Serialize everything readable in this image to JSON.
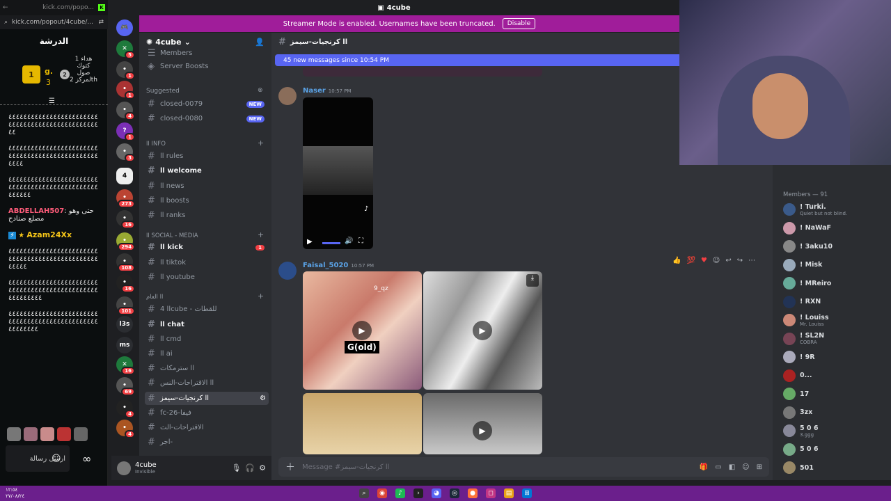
{
  "kick": {
    "url": "kick.com/popout/4cube/...",
    "tab_title": "kick.com/popo...",
    "header": "الدرشة",
    "leaderboard": {
      "first_rank": "1",
      "first_name": "g.",
      "first_score": "3",
      "second_rank": "2",
      "second_text": "هداء 1 كتوك صول لمركز 2th"
    },
    "messages": [
      "٤٤٤٤٤٤٤٤٤٤٤٤٤٤٤٤٤٤٤٤٤٤٤٤٤٤٤٤٤٤٤٤٤٤٤٤٤٤٤٤٤٤٤٤٤٤٤٤٤٤",
      "٤٤٤٤٤٤٤٤٤٤٤٤٤٤٤٤٤٤٤٤٤٤٤٤٤٤٤٤٤٤٤٤٤٤٤٤٤٤٤٤٤٤٤٤٤٤٤٤٤٤٤٤",
      "٤٤٤٤٤٤٤٤٤٤٤٤٤٤٤٤٤٤٤٤٤٤٤٤٤٤٤٤٤٤٤٤٤٤٤٤٤٤٤٤٤٤٤٤٤٤٤٤٤٤٤٤٤٤"
    ],
    "user1": "ABDELLAH507",
    "user1_msg": "حتى وهو مصلع صنادح",
    "user2": "Azam24Xx",
    "messages2": [
      "٤٤٤٤٤٤٤٤٤٤٤٤٤٤٤٤٤٤٤٤٤٤٤٤٤٤٤٤٤٤٤٤٤٤٤٤٤٤٤٤٤٤٤٤٤٤٤٤٤٤٤٤٤",
      "٤٤٤٤٤٤٤٤٤٤٤٤٤٤٤٤٤٤٤٤٤٤٤٤٤٤٤٤٤٤٤٤٤٤٤٤٤٤٤٤٤٤٤٤٤٤٤٤٤٤٤٤٤٤٤٤٤",
      "٤٤٤٤٤٤٤٤٤٤٤٤٤٤٤٤٤٤٤٤٤٤٤٤٤٤٤٤٤٤٤٤٤٤٤٤٤٤٤٤٤٤٤٤٤٤٤٤٤٤٤٤٤٤٤٤"
    ],
    "input_placeholder": "ارسل رسالة"
  },
  "discord": {
    "window_title": "4cube",
    "streamer_text": "Streamer Mode is enabled. Usernames have been truncated.",
    "disable_label": "Disable",
    "server_name": "4cube",
    "channels_top": [
      {
        "name": "Members"
      },
      {
        "name": "Server Boosts"
      }
    ],
    "suggested_label": "Suggested",
    "suggested": [
      {
        "name": "closed-0079",
        "badge": "NEW"
      },
      {
        "name": "closed-0080",
        "badge": "NEW"
      }
    ],
    "cat_info": "اا info",
    "info_channels": [
      "اا rules",
      "اا welcome",
      "اا news",
      "اا boosts",
      "اا ranks"
    ],
    "cat_social": "اا social - media",
    "social_channels": [
      "اا kick",
      "اا tiktok",
      "اا youtube"
    ],
    "cat_general": "اا العام",
    "general_channels": [
      "اا 4cube - للقطات",
      "اا chat",
      "اا cmd",
      "اا ai",
      "اا سترمكات",
      "اا الاقتراحات-النس",
      "اا كرنجيات-سيمز",
      "fc-26-فيفا",
      "الاقتراحات-الث",
      "اجر-"
    ],
    "kick_badge": "1",
    "user_name": "4cube",
    "user_status": "Invisible",
    "channel_title": "اا كرنجيات-سيمز",
    "new_messages": "45 new messages since 10:54 PM",
    "msg1": {
      "author": "Naser",
      "time": "10:57 PM"
    },
    "msg2": {
      "author": "Faisal_5020",
      "time": "10:57 PM",
      "video_label": "G(old)",
      "tag": "9_qz"
    },
    "composer_placeholder": "Message #اا كرنجيات-سيمز",
    "members_header": "Members — 91",
    "members": [
      {
        "name": "! Turki.",
        "sub": "Quiet but not blind."
      },
      {
        "name": "! NaWaF",
        "sub": ""
      },
      {
        "name": "! 3aku10",
        "sub": ""
      },
      {
        "name": "! Misk",
        "sub": ""
      },
      {
        "name": "! MReiro",
        "sub": ""
      },
      {
        "name": "! RXN",
        "sub": ""
      },
      {
        "name": "! Louiss",
        "sub": "Mr. Louiss"
      },
      {
        "name": "! SL2N",
        "sub": "COBRA"
      },
      {
        "name": "! 9R",
        "sub": ""
      },
      {
        "name": "0...",
        "sub": ""
      },
      {
        "name": "17",
        "sub": ""
      },
      {
        "name": "3zx",
        "sub": ""
      },
      {
        "name": "5 0 6",
        "sub": "3.ggg"
      },
      {
        "name": "5 0 6",
        "sub": ""
      },
      {
        "name": "501",
        "sub": ""
      }
    ]
  },
  "taskbar": {
    "clock": "١٢:٥٤",
    "date": "٢٧/٠٨/٢٤"
  },
  "colors": {
    "accent": "#5865f2",
    "streamer": "#a01d9a",
    "kick_green": "#53fc18"
  }
}
